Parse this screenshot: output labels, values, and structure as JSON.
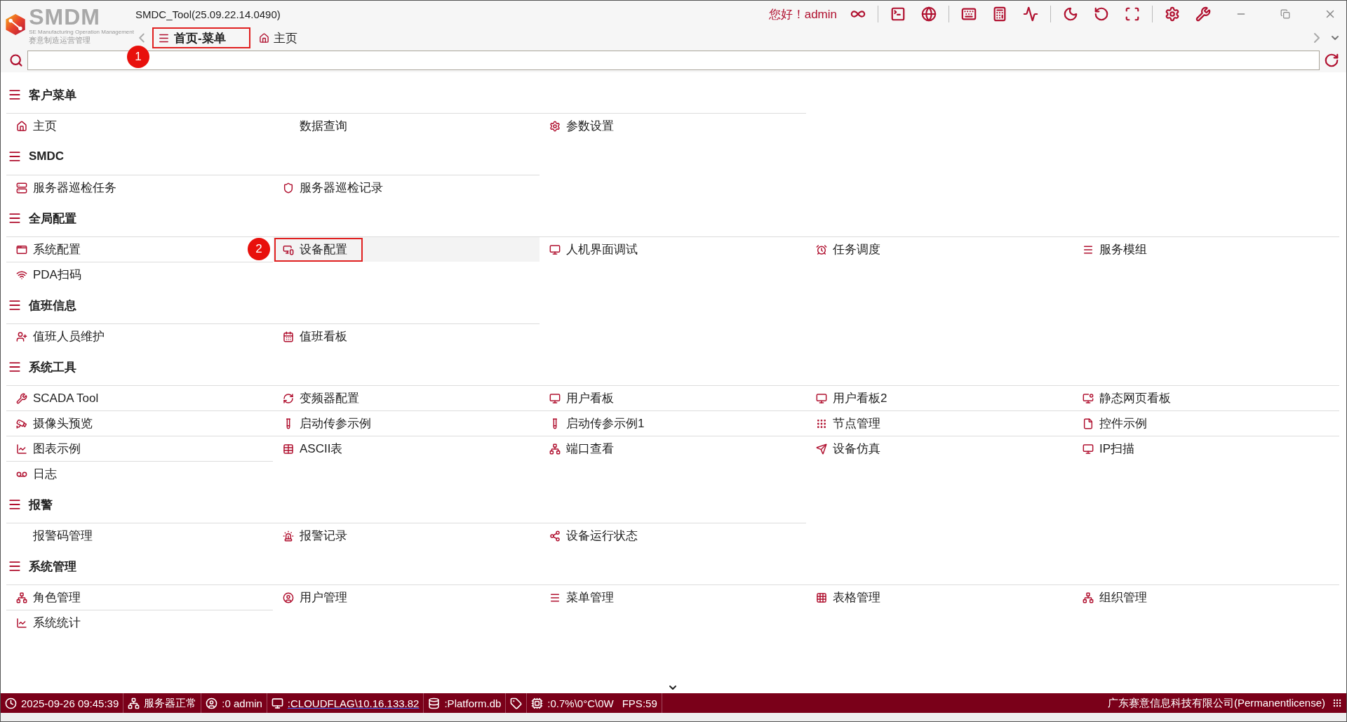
{
  "logo": {
    "name": "SMDM",
    "subtitle": "SE Manufacturing Operation Management",
    "tagline": "赛意制造运营管理"
  },
  "window": {
    "title": "SMDC_Tool(25.09.22.14.0490)"
  },
  "greeting": "您好！admin",
  "tabs": [
    {
      "label": "首页-菜单",
      "selected": true,
      "highlighted": true,
      "marker": "1"
    },
    {
      "label": "主页",
      "selected": false,
      "highlighted": false
    }
  ],
  "sections": [
    {
      "title": "客户菜单",
      "items": [
        {
          "label": "主页",
          "selected": false,
          "highlighted": false
        },
        {
          "label": "数据查询",
          "selected": false,
          "highlighted": false
        },
        {
          "label": "参数设置",
          "selected": false,
          "highlighted": false
        }
      ]
    },
    {
      "title": "SMDC",
      "items": [
        {
          "label": "服务器巡检任务",
          "selected": false,
          "highlighted": false
        },
        {
          "label": "服务器巡检记录",
          "selected": false,
          "highlighted": false
        }
      ]
    },
    {
      "title": "全局配置",
      "items": [
        {
          "label": "系统配置",
          "selected": false,
          "highlighted": false
        },
        {
          "label": "设备配置",
          "selected": true,
          "highlighted": true,
          "marker": "2"
        },
        {
          "label": "人机界面调试",
          "selected": false,
          "highlighted": false
        },
        {
          "label": "任务调度",
          "selected": false,
          "highlighted": false
        },
        {
          "label": "服务模组",
          "selected": false,
          "highlighted": false
        },
        {
          "label": "PDA扫码",
          "selected": false,
          "highlighted": false
        }
      ]
    },
    {
      "title": "值班信息",
      "items": [
        {
          "label": "值班人员维护",
          "selected": false,
          "highlighted": false
        },
        {
          "label": "值班看板",
          "selected": false,
          "highlighted": false
        }
      ]
    },
    {
      "title": "系统工具",
      "items": [
        {
          "label": "SCADA Tool",
          "selected": false,
          "highlighted": false
        },
        {
          "label": "变频器配置",
          "selected": false,
          "highlighted": false
        },
        {
          "label": "用户看板",
          "selected": false,
          "highlighted": false
        },
        {
          "label": "用户看板2",
          "selected": false,
          "highlighted": false
        },
        {
          "label": "静态网页看板",
          "selected": false,
          "highlighted": false
        },
        {
          "label": "摄像头预览",
          "selected": false,
          "highlighted": false
        },
        {
          "label": "启动传参示例",
          "selected": false,
          "highlighted": false
        },
        {
          "label": "启动传参示例1",
          "selected": false,
          "highlighted": false
        },
        {
          "label": "节点管理",
          "selected": false,
          "highlighted": false
        },
        {
          "label": "控件示例",
          "selected": false,
          "highlighted": false
        },
        {
          "label": "图表示例",
          "selected": false,
          "highlighted": false
        },
        {
          "label": "ASCII表",
          "selected": false,
          "highlighted": false
        },
        {
          "label": "端口查看",
          "selected": false,
          "highlighted": false
        },
        {
          "label": "设备仿真",
          "selected": false,
          "highlighted": false
        },
        {
          "label": "IP扫描",
          "selected": false,
          "highlighted": false
        },
        {
          "label": "日志",
          "selected": false,
          "highlighted": false
        }
      ]
    },
    {
      "title": "报警",
      "items": [
        {
          "label": "报警码管理",
          "selected": false,
          "highlighted": false
        },
        {
          "label": "报警记录",
          "selected": false,
          "highlighted": false
        },
        {
          "label": "设备运行状态",
          "selected": false,
          "highlighted": false
        }
      ]
    },
    {
      "title": "系统管理",
      "items": [
        {
          "label": "角色管理",
          "selected": false,
          "highlighted": false
        },
        {
          "label": "用户管理",
          "selected": false,
          "highlighted": false
        },
        {
          "label": "菜单管理",
          "selected": false,
          "highlighted": false
        },
        {
          "label": "表格管理",
          "selected": false,
          "highlighted": false
        },
        {
          "label": "组织管理",
          "selected": false,
          "highlighted": false
        },
        {
          "label": "系统统计",
          "selected": false,
          "highlighted": false
        }
      ]
    }
  ],
  "status_bar": {
    "time": "2025-09-26 09:45:39",
    "server": "服务器正常",
    "user": ":0 admin",
    "host": ":CLOUDFLAG\\10.16.133.82",
    "database": ":Platform.db",
    "usage": ":0.7%\\0°C\\0W",
    "fps": "FPS:59",
    "company": "广东赛意信息科技有限公司(Permanentlicense)"
  }
}
